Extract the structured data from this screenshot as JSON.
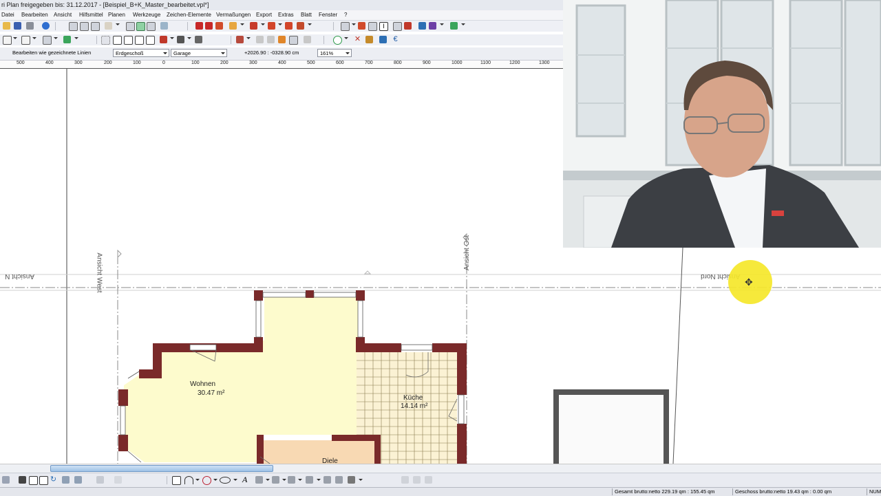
{
  "window": {
    "title": "ri Plan freigegeben bis: 31.12.2017 - [Beispiel_B+K_Master_bearbeitet.vpl*]"
  },
  "menu": [
    "Datei",
    "Bearbeiten",
    "Ansicht",
    "Hilfsmittel",
    "Planen",
    "Werkzeuge",
    "Zeichen-Elemente",
    "Vermaßungen",
    "Export",
    "Extras",
    "Blatt",
    "Fenster",
    "?"
  ],
  "property_bar": {
    "mode_label": "Bearbeiten wie gezeichnete Linien",
    "floor_select": "Erdgeschoß",
    "room_select": "Garage",
    "coordinates": "+2026.90 : -0328.90 cm",
    "zoom": "161%"
  },
  "ruler": [
    "500",
    "400",
    "300",
    "200",
    "100",
    "0",
    "100",
    "200",
    "300",
    "400",
    "500",
    "600",
    "700",
    "800",
    "900",
    "1000",
    "1100",
    "1200",
    "1300"
  ],
  "drawing": {
    "views": {
      "west": "Ansicht West",
      "east": "Ansicht Ost",
      "north": "Ansicht Nord",
      "north_left": "Ansicht N"
    },
    "rooms": [
      {
        "name": "Wohnen",
        "area": "30.47 m²"
      },
      {
        "name": "Küche",
        "area": "14.14 m²"
      },
      {
        "name": "Diele",
        "area": ""
      }
    ]
  },
  "statusbar": {
    "gesamt": "Gesamt brutto:netto 229.19 qm : 155.45 qm",
    "geschoss": "Geschoss brutto:netto 19.43 qm : 0.00 qm",
    "num": "NUM"
  },
  "colors": {
    "wall": "#7a2a2a",
    "wohnen_fill": "#fdfbcd",
    "kueche_fill": "#fbf2d4",
    "diele_fill": "#f8d9b3",
    "highlight": "#f5e72a"
  }
}
